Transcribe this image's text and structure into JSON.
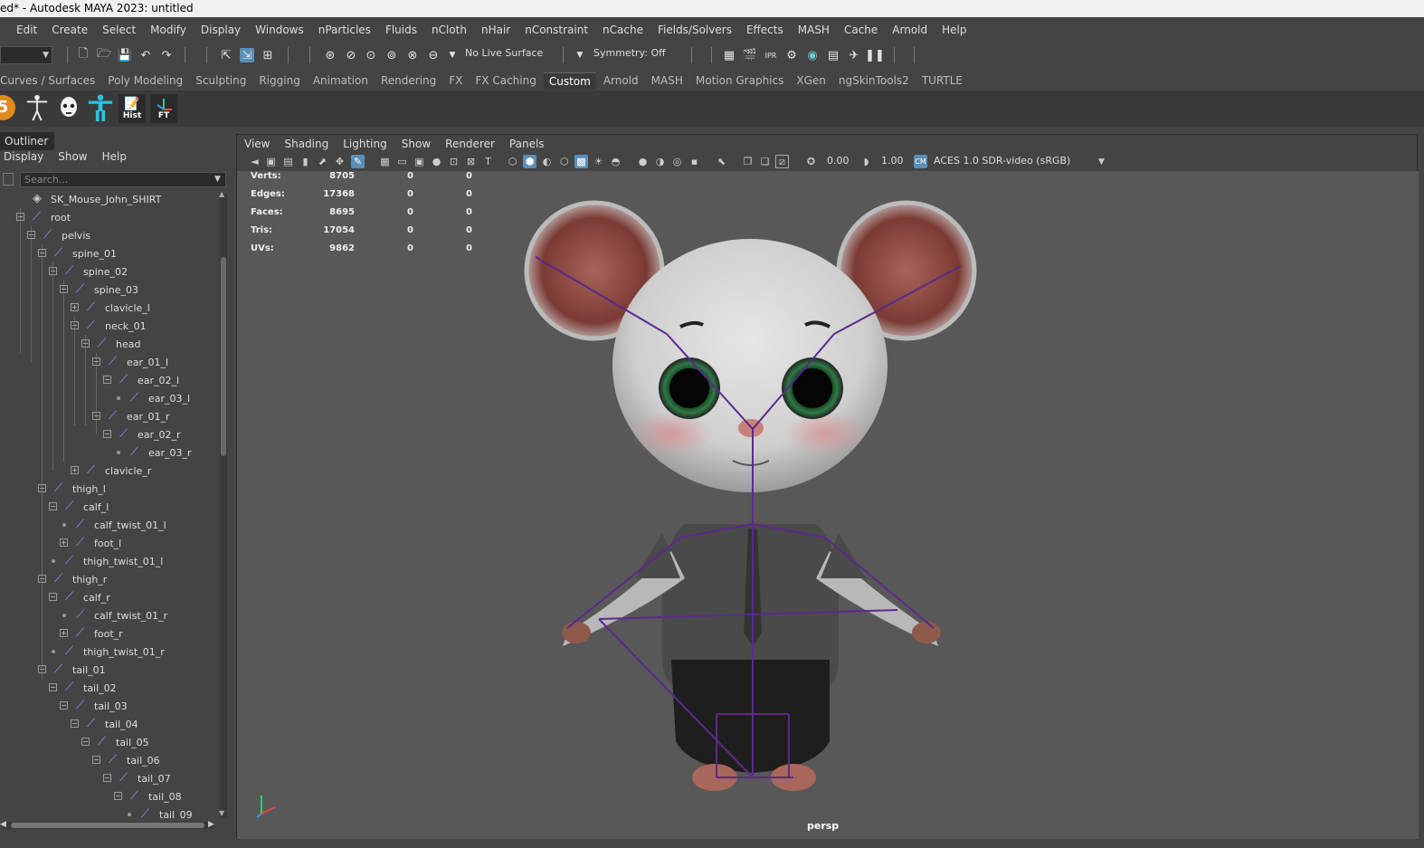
{
  "window": {
    "title": "ed* - Autodesk MAYA 2023: untitled"
  },
  "menus": [
    "Edit",
    "Create",
    "Select",
    "Modify",
    "Display",
    "Windows",
    "nParticles",
    "Fluids",
    "nCloth",
    "nHair",
    "nConstraint",
    "nCache",
    "Fields/Solvers",
    "Effects",
    "MASH",
    "Cache",
    "Arnold",
    "Help"
  ],
  "toolbar": {
    "live_surface": "No Live Surface",
    "symmetry": "Symmetry: Off"
  },
  "shelf": {
    "tabs": [
      "Curves / Surfaces",
      "Poly Modeling",
      "Sculpting",
      "Rigging",
      "Animation",
      "Rendering",
      "FX",
      "FX Caching",
      "Custom",
      "Arnold",
      "MASH",
      "Motion Graphics",
      "XGen",
      "ngSkinTools2",
      "TURTLE"
    ],
    "active_tab": "Custom",
    "buttons": [
      {
        "name": "python-5-icon",
        "label": ""
      },
      {
        "name": "skeleton-tpose-icon",
        "label": ""
      },
      {
        "name": "mask-icon",
        "label": ""
      },
      {
        "name": "tpose-blue-icon",
        "label": ""
      },
      {
        "name": "history-icon",
        "label": "Hist"
      },
      {
        "name": "freeze-transform-icon",
        "label": "FT"
      }
    ]
  },
  "outliner": {
    "title": "Outliner",
    "menu": [
      "Display",
      "Show",
      "Help"
    ],
    "search_placeholder": "Search...",
    "items": [
      {
        "label": "SK_Mouse_John_SHIRT",
        "depth": 0,
        "expander": "",
        "icon": "mesh"
      },
      {
        "label": "root",
        "depth": 0,
        "expander": "minus"
      },
      {
        "label": "pelvis",
        "depth": 1,
        "expander": "minus"
      },
      {
        "label": "spine_01",
        "depth": 2,
        "expander": "minus"
      },
      {
        "label": "spine_02",
        "depth": 3,
        "expander": "minus"
      },
      {
        "label": "spine_03",
        "depth": 4,
        "expander": "minus"
      },
      {
        "label": "clavicle_l",
        "depth": 5,
        "expander": "plus"
      },
      {
        "label": "neck_01",
        "depth": 5,
        "expander": "minus"
      },
      {
        "label": "head",
        "depth": 6,
        "expander": "minus"
      },
      {
        "label": "ear_01_l",
        "depth": 7,
        "expander": "minus"
      },
      {
        "label": "ear_02_l",
        "depth": 8,
        "expander": "minus"
      },
      {
        "label": "ear_03_l",
        "depth": 9,
        "expander": "dot"
      },
      {
        "label": "ear_01_r",
        "depth": 7,
        "expander": "minus"
      },
      {
        "label": "ear_02_r",
        "depth": 8,
        "expander": "minus"
      },
      {
        "label": "ear_03_r",
        "depth": 9,
        "expander": "dot"
      },
      {
        "label": "clavicle_r",
        "depth": 5,
        "expander": "plus"
      },
      {
        "label": "thigh_l",
        "depth": 2,
        "expander": "minus"
      },
      {
        "label": "calf_l",
        "depth": 3,
        "expander": "minus"
      },
      {
        "label": "calf_twist_01_l",
        "depth": 4,
        "expander": "dot"
      },
      {
        "label": "foot_l",
        "depth": 4,
        "expander": "plus"
      },
      {
        "label": "thigh_twist_01_l",
        "depth": 3,
        "expander": "dot"
      },
      {
        "label": "thigh_r",
        "depth": 2,
        "expander": "minus"
      },
      {
        "label": "calf_r",
        "depth": 3,
        "expander": "minus"
      },
      {
        "label": "calf_twist_01_r",
        "depth": 4,
        "expander": "dot"
      },
      {
        "label": "foot_r",
        "depth": 4,
        "expander": "plus"
      },
      {
        "label": "thigh_twist_01_r",
        "depth": 3,
        "expander": "dot"
      },
      {
        "label": "tail_01",
        "depth": 2,
        "expander": "minus"
      },
      {
        "label": "tail_02",
        "depth": 3,
        "expander": "minus"
      },
      {
        "label": "tail_03",
        "depth": 4,
        "expander": "minus"
      },
      {
        "label": "tail_04",
        "depth": 5,
        "expander": "minus"
      },
      {
        "label": "tail_05",
        "depth": 6,
        "expander": "minus"
      },
      {
        "label": "tail_06",
        "depth": 7,
        "expander": "minus"
      },
      {
        "label": "tail_07",
        "depth": 8,
        "expander": "minus"
      },
      {
        "label": "tail_08",
        "depth": 9,
        "expander": "minus"
      },
      {
        "label": "tail_09",
        "depth": 10,
        "expander": "dot"
      }
    ]
  },
  "viewport": {
    "menu": [
      "View",
      "Shading",
      "Lighting",
      "Show",
      "Renderer",
      "Panels"
    ],
    "near_value": "0.00",
    "far_value": "1.00",
    "color_space": "ACES 1.0 SDR-video (sRGB)",
    "camera": "persp",
    "stats": [
      {
        "label": "Verts:",
        "values": [
          "8705",
          "0",
          "0"
        ]
      },
      {
        "label": "Edges:",
        "values": [
          "17368",
          "0",
          "0"
        ]
      },
      {
        "label": "Faces:",
        "values": [
          "8695",
          "0",
          "0"
        ]
      },
      {
        "label": "Tris:",
        "values": [
          "17054",
          "0",
          "0"
        ]
      },
      {
        "label": "UVs:",
        "values": [
          "9862",
          "0",
          "0"
        ]
      }
    ]
  }
}
